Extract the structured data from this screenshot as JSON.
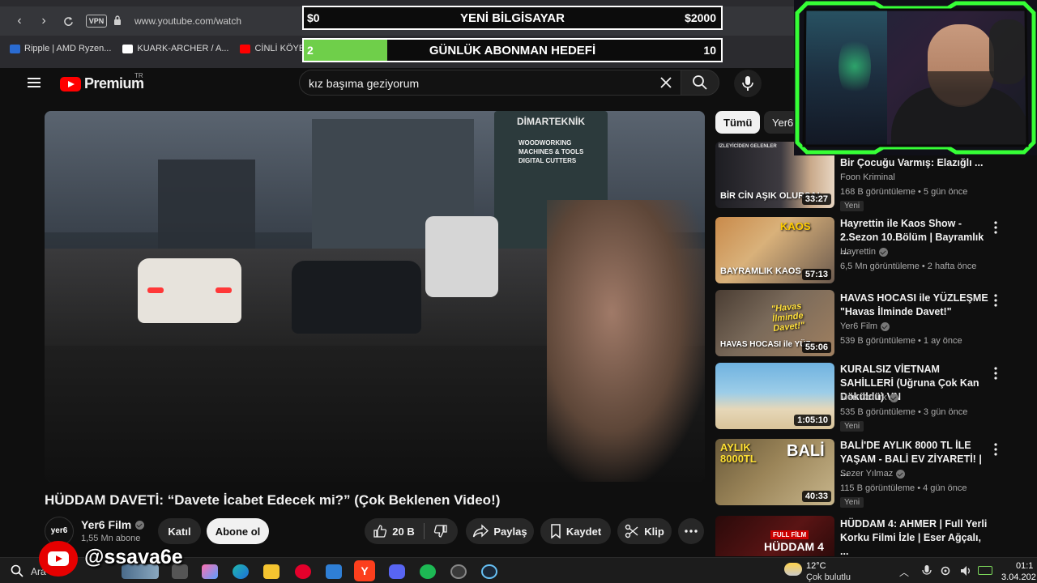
{
  "browser": {
    "url": "www.youtube.com/watch",
    "vpn_label": "VPN",
    "bookmarks": [
      "Ripple | AMD Ryzen...",
      "KUARK-ARCHER / A...",
      "CİNLİ KÖYE Gİ"
    ]
  },
  "overlay": {
    "goal1": {
      "left": "$0",
      "center": "YENİ BİLGİSAYAR",
      "right": "$2000"
    },
    "goal2": {
      "left": "2",
      "center": "GÜNLÜK ABONMAN HEDEFİ",
      "right": "10",
      "progress": 0.2
    },
    "handle": "@ssava6e"
  },
  "header": {
    "logo_text": "Premium",
    "logo_region": "TR",
    "search_value": "kız başıma geziyorum"
  },
  "video": {
    "sign_top": "DİMARTEKNİK",
    "sign_lines": [
      "WOODWORKING",
      "MACHINES & TOOLS",
      "DIGITAL CUTTERS"
    ],
    "title": "HÜDDAM DAVETİ: “Davete İcabet Edecek mi?” (Çok Beklenen Video!)",
    "channel": "Yer6 Film",
    "channel_avatar": "yer6",
    "subs": "1,55 Mn abone",
    "join_label": "Katıl",
    "subscribe_label": "Abone ol",
    "likes": "20 B",
    "share_label": "Paylaş",
    "save_label": "Kaydet",
    "clip_label": "Klip"
  },
  "sidebar": {
    "chips": [
      "Tümü",
      "Yer6"
    ],
    "recs": [
      {
        "title": "Bir Çocuğu Varmış: Elazığlı ...",
        "channel": "Foon Kriminal",
        "meta": "168 B görüntüleme • 5 gün önce",
        "badge": "Yeni",
        "duration": "33:27",
        "caption": "BİR CİN AŞIK OLURSA!",
        "thumb_tag": "İZLEYİCİDEN GELENLER",
        "verified": false
      },
      {
        "title": "Hayrettin ile Kaos Show - 2.Sezon 10.Bölüm | Bayramlık ...",
        "channel": "Hayrettin",
        "meta": "6,5 Mn görüntüleme • 2 hafta önce",
        "badge": "",
        "duration": "57:13",
        "caption": "BAYRAMLIK KAOS",
        "thumb_tag": "KAOS",
        "verified": true
      },
      {
        "title": "HAVAS HOCASI ile YÜZLEŞME \"Havas İlminde Davet!\"",
        "channel": "Yer6 Film",
        "meta": "539 B görüntüleme • 1 ay önce",
        "badge": "",
        "duration": "55:06",
        "caption": "HAVAS HOCASI ile YÜZ",
        "thumb_tag": "\"Havas İlminde Davet!\"",
        "verified": true
      },
      {
        "title": "KURALSIZ VİETNAM SAHİLLERİ (Uğruna Çok Kan Döküldü) VN",
        "channel": "Mert Öztürk",
        "meta": "535 B görüntüleme • 3 gün önce",
        "badge": "Yeni",
        "duration": "1:05:10",
        "caption": "",
        "thumb_tag": "",
        "verified": true
      },
      {
        "title": "BALİ'DE AYLIK 8000 TL İLE YAŞAM - BALİ EV ZİYARETİ! | ...",
        "channel": "Sezer Yılmaz",
        "meta": "115 B görüntüleme • 4 gün önce",
        "badge": "Yeni",
        "duration": "40:33",
        "caption": "AYLIK 8000TL",
        "thumb_tag": "BALİ",
        "verified": true
      },
      {
        "title": "HÜDDAM 4: AHMER | Full Yerli Korku Filmi İzle | Eser Ağçalı, ...",
        "channel": "",
        "meta": "",
        "badge": "",
        "duration": "",
        "caption": "HÜDDAM 4",
        "thumb_tag": "FULL FİLM",
        "verified": false
      }
    ]
  },
  "taskbar": {
    "search_text": "Ara",
    "weather_temp": "12°C",
    "weather_desc": "Çok bulutlu",
    "time": "01:1",
    "date": "3.04.202"
  },
  "colors": {
    "yt_red": "#ff0000",
    "goal_fill": "#6fcf4a",
    "webcam_frame": "#3aff3a"
  }
}
